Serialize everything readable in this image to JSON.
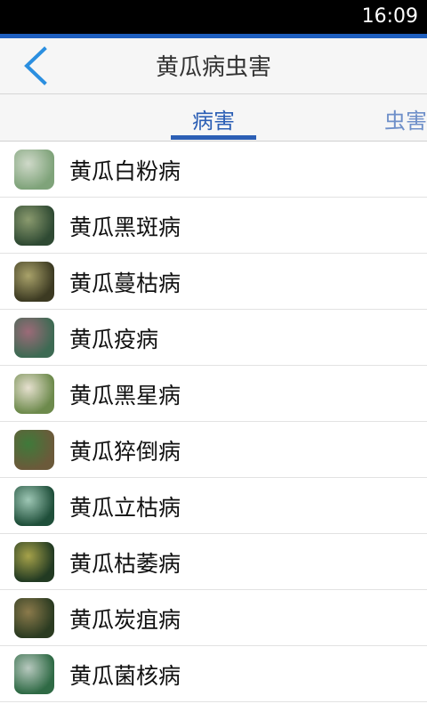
{
  "status_bar": {
    "time": "16:09"
  },
  "header": {
    "title": "黄瓜病虫害"
  },
  "tabs": [
    {
      "label": "病害",
      "active": true
    },
    {
      "label": "虫害",
      "active": false
    }
  ],
  "list": [
    {
      "label": "黄瓜白粉病",
      "thumb_colors": [
        "#7fa37a",
        "#cfd9c9"
      ]
    },
    {
      "label": "黄瓜黑斑病",
      "thumb_colors": [
        "#2f4a33",
        "#8a9a6e"
      ]
    },
    {
      "label": "黄瓜蔓枯病",
      "thumb_colors": [
        "#3c3a22",
        "#a9a26a"
      ]
    },
    {
      "label": "黄瓜疫病",
      "thumb_colors": [
        "#3d6a53",
        "#9c6a78"
      ]
    },
    {
      "label": "黄瓜黑星病",
      "thumb_colors": [
        "#6d8a4c",
        "#e6e0cf"
      ]
    },
    {
      "label": "黄瓜猝倒病",
      "thumb_colors": [
        "#6b5a3a",
        "#3f7a3a"
      ]
    },
    {
      "label": "黄瓜立枯病",
      "thumb_colors": [
        "#1f4f3a",
        "#9ec7b5"
      ]
    },
    {
      "label": "黄瓜枯萎病",
      "thumb_colors": [
        "#223a22",
        "#a6a24a"
      ]
    },
    {
      "label": "黄瓜炭疽病",
      "thumb_colors": [
        "#2b3b21",
        "#8b7a4b"
      ]
    },
    {
      "label": "黄瓜菌核病",
      "thumb_colors": [
        "#2f6a45",
        "#b8c9bf"
      ]
    }
  ],
  "colors": {
    "accent": "#2c5fb5",
    "back_arrow": "#2b8fe0",
    "status_bar": "#000000"
  }
}
